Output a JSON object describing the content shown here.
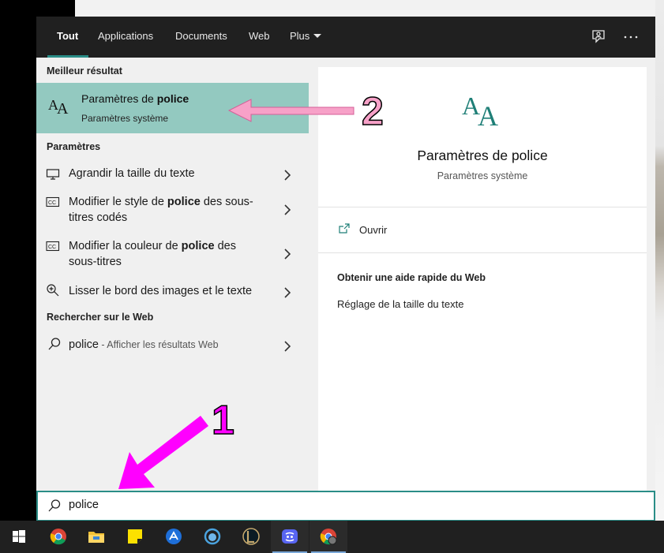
{
  "tabs": [
    {
      "label": "Tout",
      "active": true
    },
    {
      "label": "Applications"
    },
    {
      "label": "Documents"
    },
    {
      "label": "Web"
    },
    {
      "label": "Plus"
    }
  ],
  "best_match": {
    "header": "Meilleur résultat",
    "title_pre": "Paramètres de ",
    "title_bold": "police",
    "subtitle": "Paramètres système",
    "icon": "font-aa-icon"
  },
  "settings": {
    "header": "Paramètres",
    "items": [
      {
        "icon": "monitor-icon",
        "pre": "Agrandir la taille du texte",
        "bold": "",
        "post": ""
      },
      {
        "icon": "closed-caption-icon",
        "pre": "Modifier le style de ",
        "bold": "police",
        "post": " des sous-titres codés"
      },
      {
        "icon": "closed-caption-icon",
        "pre": "Modifier la couleur de ",
        "bold": "police",
        "post": " des sous-titres"
      },
      {
        "icon": "magnifier-plus-icon",
        "pre": "Lisser le bord des images et le texte",
        "bold": "",
        "post": ""
      }
    ]
  },
  "web": {
    "header": "Rechercher sur le Web",
    "query": "police",
    "hint": " - Afficher les résultats Web"
  },
  "detail": {
    "title": "Paramètres de police",
    "subtitle": "Paramètres système",
    "open_label": "Ouvrir",
    "web_help_header": "Obtenir une aide rapide du Web",
    "web_help_link": "Réglage de la taille du texte"
  },
  "search": {
    "value": "police"
  },
  "annotations": {
    "label_1": "1",
    "label_2": "2",
    "color": "#ff00ff",
    "color_2": "#f7a1c8"
  },
  "taskbar": [
    "windows-start-icon",
    "chrome-icon",
    "file-explorer-icon",
    "sticky-notes-icon",
    "vpn-app-icon",
    "blue-circle-app-icon",
    "league-of-legends-icon",
    "discord-icon",
    "chrome-profile-icon"
  ],
  "colors": {
    "accent": "#2a8d87",
    "selected": "#93c9c0",
    "topbar": "#202020"
  }
}
